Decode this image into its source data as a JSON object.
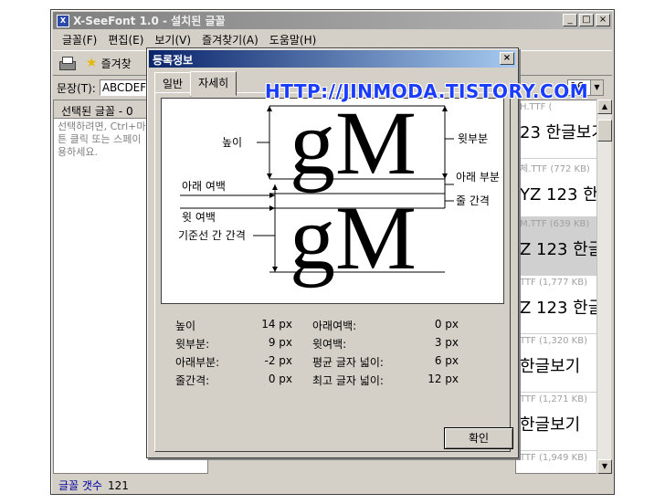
{
  "window": {
    "title": "X-SeeFont 1.0 - 설치된 글꼴",
    "min_glyph": "_",
    "max_glyph": "□",
    "close_glyph": "×"
  },
  "menu": [
    "글꼴(F)",
    "편집(E)",
    "보기(V)",
    "즐겨찾기(A)",
    "도움말(H)"
  ],
  "toolbar": {
    "favorites_label": "즐겨찾"
  },
  "sentence": {
    "label": "문장(T):",
    "value": "ABCDEF"
  },
  "size_select": {
    "value": "16"
  },
  "left_panel": {
    "header": "선택된 글꼴 - 0",
    "hint": "선택하려면, Ctrl+마\n튼 클릭 또는 스페이\n용하세요."
  },
  "status": {
    "label": "글꼴 갯수",
    "count": "121"
  },
  "font_list": [
    {
      "meta": "H.TTF (",
      "sample": "23 한글보기"
    },
    {
      "meta": "체.TTF (772 KB)",
      "sample": "YZ 123 한"
    },
    {
      "meta": "M.TTF (639 KB)",
      "sample": "Z 123 한글"
    },
    {
      "meta": "TTF (1,777 KB)",
      "sample": "Z 123 한글"
    },
    {
      "meta": "TTF (1,320 KB)",
      "sample": "한글보기"
    },
    {
      "meta": "TTF (1,271 KB)",
      "sample": "한글보기"
    },
    {
      "meta": "TTF (1,949 KB)",
      "sample": ""
    }
  ],
  "dialog": {
    "title": "등록정보",
    "close_glyph": "×",
    "tabs": [
      "일반",
      "자세히"
    ],
    "preview": {
      "glyphs": "gM",
      "labels": {
        "height": "높이",
        "bottom_margin": "아래 여백",
        "top_margin": "윗 여백",
        "baseline_gap": "기준선 간 간격",
        "ascent": "윗부분",
        "descent": "아래 부분",
        "line_gap": "줄 간격"
      }
    },
    "metrics": [
      {
        "k1": "높이",
        "v1": "14 px",
        "k2": "아래여백:",
        "v2": "0 px"
      },
      {
        "k1": "윗부분:",
        "v1": "9 px",
        "k2": "윗여백:",
        "v2": "3 px"
      },
      {
        "k1": "아래부분:",
        "v1": "-2 px",
        "k2": "평균 글자 넓이:",
        "v2": "6 px"
      },
      {
        "k1": "줄간격:",
        "v1": "0 px",
        "k2": "최고 글자 넓이:",
        "v2": "12 px"
      }
    ],
    "ok_label": "확인"
  },
  "watermark": "HTTP://JINMODA.TISTORY.COM"
}
